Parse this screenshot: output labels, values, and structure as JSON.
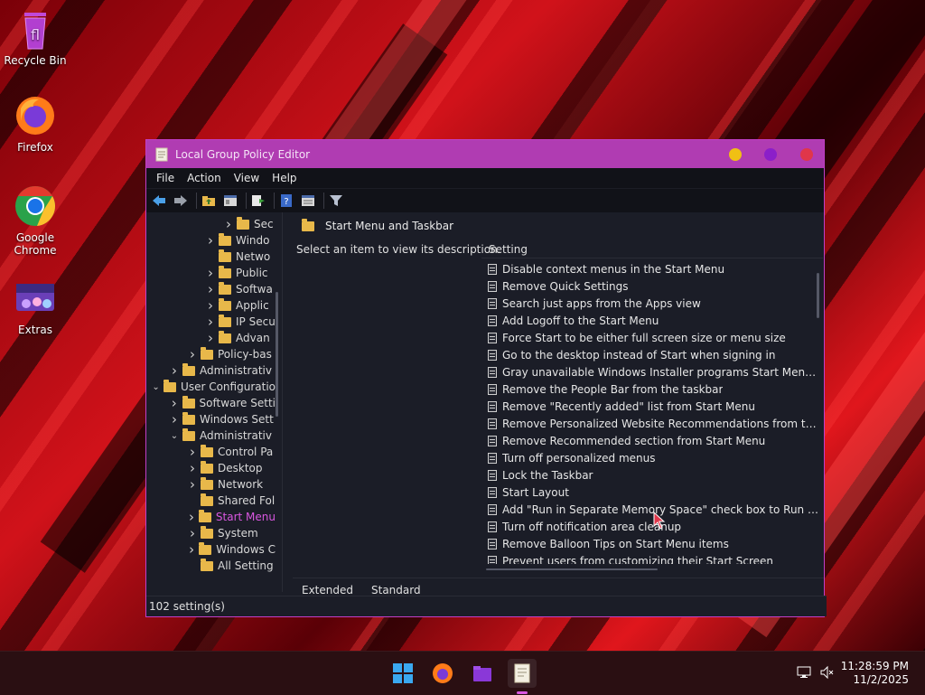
{
  "desktop": {
    "icons": [
      {
        "label": "Recycle Bin",
        "icon": "recycle-bin-icon"
      },
      {
        "label": "Firefox",
        "icon": "firefox-icon"
      },
      {
        "label": "Google Chrome",
        "icon": "chrome-icon"
      },
      {
        "label": "Extras",
        "icon": "extras-icon"
      }
    ]
  },
  "window": {
    "title": "Local Group Policy Editor",
    "controls": {
      "minimize": "#f0c014",
      "maximize": "#8b1fc9",
      "close": "#e0364a"
    },
    "accent": "#b03cb2",
    "menu": [
      "File",
      "Action",
      "View",
      "Help"
    ],
    "toolbar": [
      "back-arrow-icon",
      "forward-arrow-icon",
      "up-folder-icon",
      "show-hide-tree-icon",
      "export-list-icon",
      "help-icon",
      "properties-icon",
      "filter-icon"
    ]
  },
  "tree": {
    "rows": [
      {
        "label": "Sec",
        "chevron": ">"
      },
      {
        "label": "Windo",
        "chevron": ">"
      },
      {
        "label": "Netwo",
        "chevron": ""
      },
      {
        "label": "Public",
        "chevron": ">"
      },
      {
        "label": "Softwa",
        "chevron": ">"
      },
      {
        "label": "Applic",
        "chevron": ">"
      },
      {
        "label": "IP Secu",
        "chevron": ">"
      },
      {
        "label": "Advan",
        "chevron": ">"
      },
      {
        "label": "Policy-bas",
        "chevron": ">"
      },
      {
        "label": "Administrativ",
        "chevron": ">"
      },
      {
        "label": "User Configuratio",
        "chevron": "v"
      },
      {
        "label": "Software Setti",
        "chevron": ">"
      },
      {
        "label": "Windows Sett",
        "chevron": ">"
      },
      {
        "label": "Administrativ",
        "chevron": "v"
      },
      {
        "label": "Control Pa",
        "chevron": ">"
      },
      {
        "label": "Desktop",
        "chevron": ">"
      },
      {
        "label": "Network",
        "chevron": ">"
      },
      {
        "label": "Shared Fol",
        "chevron": ""
      },
      {
        "label": "Start Menu",
        "chevron": ">"
      },
      {
        "label": "System",
        "chevron": ">"
      },
      {
        "label": "Windows C",
        "chevron": ">"
      },
      {
        "label": "All Setting",
        "chevron": ""
      }
    ]
  },
  "pane": {
    "header": "Start Menu and Taskbar",
    "description": "Select an item to view its description.",
    "column": "Setting",
    "items": [
      "Disable context menus in the Start Menu",
      "Remove Quick Settings",
      "Search just apps from the Apps view",
      "Add Logoff to the Start Menu",
      "Force Start to be either full screen size or menu size",
      "Go to the desktop instead of Start when signing in",
      "Gray unavailable Windows Installer programs Start Menu sh...",
      "Remove the People Bar from the taskbar",
      "Remove \"Recently added\" list from Start Menu",
      "Remove Personalized Website Recommendations from the ...",
      "Remove Recommended section from Start Menu",
      "Turn off personalized menus",
      "Lock the Taskbar",
      "Start Layout",
      "Add \"Run in Separate Memory Space\" check box to Run dial...",
      "Turn off notification area cleanup",
      "Remove Balloon Tips on Start Menu items",
      "Prevent users from customizing their Start Screen"
    ],
    "tabs": [
      "Extended",
      "Standard"
    ]
  },
  "status": "102 setting(s)",
  "taskbar": {
    "apps": [
      "windows-start-icon",
      "firefox-icon",
      "file-explorer-icon",
      "group-policy-editor-icon"
    ],
    "time": "11:28:59 PM",
    "date": "11/2/2025"
  }
}
